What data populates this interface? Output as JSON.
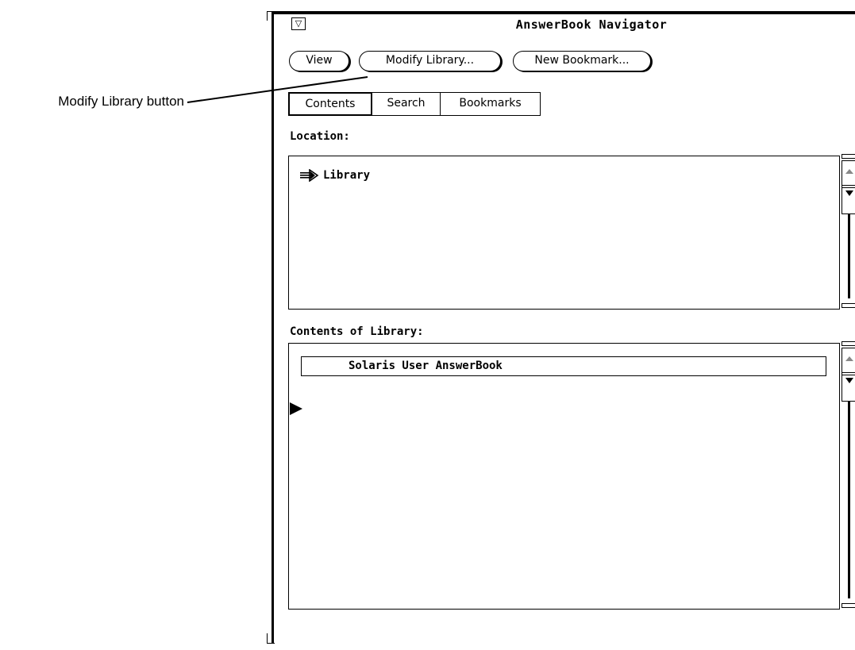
{
  "callout": {
    "label": "Modify Library button"
  },
  "window": {
    "title": "AnswerBook Navigator",
    "menu_glyph": "▽"
  },
  "buttons": {
    "view": "View",
    "modify_library": "Modify Library...",
    "new_bookmark": "New Bookmark..."
  },
  "tabs": [
    {
      "label": "Contents",
      "selected": true
    },
    {
      "label": "Search",
      "selected": false
    },
    {
      "label": "Bookmarks",
      "selected": false
    }
  ],
  "location": {
    "label": "Location:",
    "current": "Library",
    "arrow_icon": "double-arrow-icon"
  },
  "contents": {
    "label": "Contents of Library:",
    "items": [
      "Solaris User AnswerBook"
    ]
  }
}
